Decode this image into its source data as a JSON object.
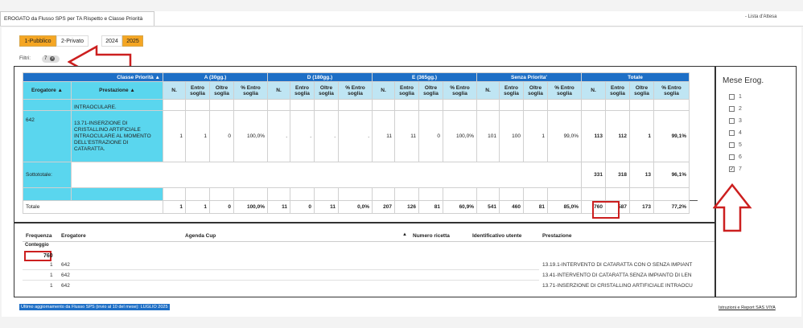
{
  "tab": {
    "title": "EROGATO da Flusso SPS per TA Rispetto e Classe Priorità",
    "right_label": "- Lista d'Attesa"
  },
  "year_buttons": [
    {
      "label": "1-Pubblico",
      "active": true
    },
    {
      "label": "2-Privato",
      "active": false
    },
    {
      "label": "2024",
      "active": false
    },
    {
      "label": "2025",
      "active": true
    }
  ],
  "filters": {
    "label": "Filtri:",
    "chip": "7"
  },
  "table": {
    "group_header": "Classe Priorità",
    "groups": [
      "A (30gg.)",
      "D (180gg.)",
      "E (365gg.)",
      "Senza Priorita'",
      "Totale"
    ],
    "col_erogatore": "Erogatore",
    "col_prestazione": "Prestazione",
    "sub": {
      "n": "N.",
      "entro": "Entro soglia",
      "oltre": "Oltre soglia",
      "pct": "% Entro soglia"
    },
    "row_clip": "INTRAOCULARE.",
    "row_main": {
      "erogatore": "642",
      "prestazione": "13.71-INSERZIONE DI CRISTALLINO ARTIFICIALE INTRAOCULARE AL MOMENTO DELL'ESTRAZIONE DI CATARATTA.",
      "values": [
        "1",
        "1",
        "0",
        "100,0%",
        ".",
        ".",
        ".",
        ".",
        "11",
        "11",
        "0",
        "100,0%",
        "101",
        "100",
        "1",
        "99,0%",
        "113",
        "112",
        "1",
        "99,1%"
      ]
    },
    "subtotal": {
      "label": "Sottototale:",
      "values": [
        "331",
        "318",
        "13",
        "96,1%"
      ]
    },
    "total": {
      "label": "Totale",
      "values": [
        "1",
        "1",
        "0",
        "100,0%",
        "11",
        "0",
        "11",
        "0,0%",
        "207",
        "126",
        "81",
        "60,9%",
        "541",
        "460",
        "81",
        "85,0%",
        "760",
        "587",
        "173",
        "77,2%"
      ]
    }
  },
  "side": {
    "title": "Mese Erog.",
    "items": [
      {
        "label": "1",
        "checked": false
      },
      {
        "label": "2",
        "checked": false
      },
      {
        "label": "3",
        "checked": false
      },
      {
        "label": "4",
        "checked": false
      },
      {
        "label": "5",
        "checked": false
      },
      {
        "label": "6",
        "checked": false
      },
      {
        "label": "7",
        "checked": true
      }
    ]
  },
  "lower": {
    "headers": {
      "freq": "Frequenza",
      "conteggio": "Conteggio",
      "erogatore": "Erogatore",
      "agenda": "Agenda Cup",
      "ricetta": "Numero ricetta",
      "utente": "Identificativo utente",
      "prestazione": "Prestazione"
    },
    "total_count": "760",
    "rows": [
      {
        "n": "1",
        "erogatore": "642",
        "prestazione": "13.19.1-INTERVENTO DI CATARATTA CON O SENZA IMPIANT"
      },
      {
        "n": "1",
        "erogatore": "642",
        "prestazione": "13.41-INTERVENTO DI CATARATTA SENZA IMPIANTO DI LEN"
      },
      {
        "n": "1",
        "erogatore": "642",
        "prestazione": "13.71-INSERZIONE DI CRISTALLINO ARTIFICIALE INTRAOCU"
      }
    ]
  },
  "footer": {
    "left": "Ultimo aggiornamento da Flusso SPS (invio al 10 del mese): LUGLIO 2025",
    "right": "Istruzioni e Report SAS VIYA"
  },
  "colors": {
    "accent_blue": "#1e6fc6",
    "cyan": "#5ad6ee",
    "orange": "#f5a623",
    "red_annotation": "#cc1f1f"
  }
}
